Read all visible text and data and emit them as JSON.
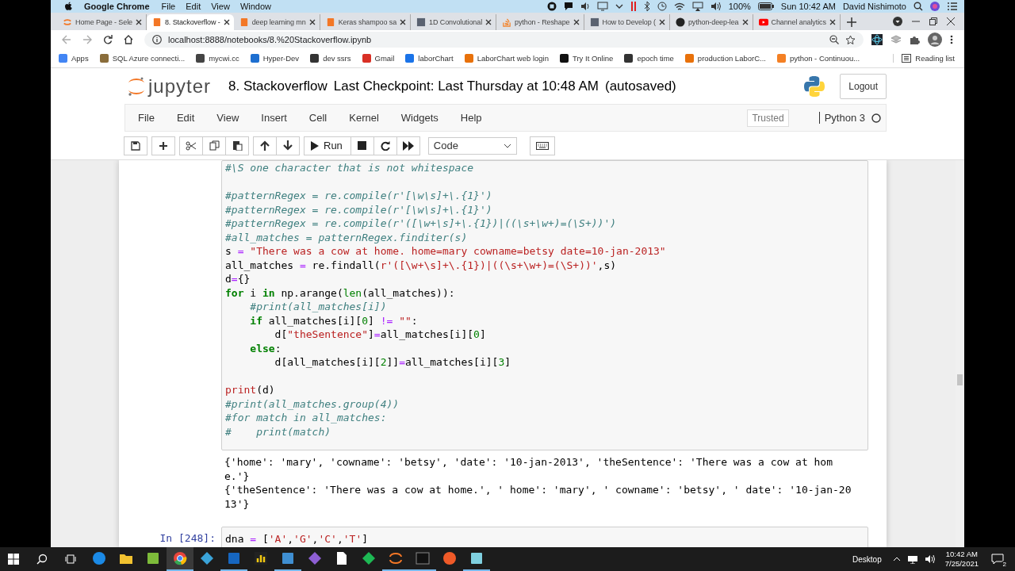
{
  "mac_menubar": {
    "app": "Google Chrome",
    "menus": [
      "File",
      "Edit",
      "View",
      "Window"
    ],
    "battery": "100%",
    "clock": "Sun 10:42 AM",
    "user": "David Nishimoto"
  },
  "tabs": [
    {
      "title": "Home Page - Sele",
      "kind": "jupyter",
      "selected": false
    },
    {
      "title": "8. Stackoverflow -",
      "kind": "notebook",
      "selected": true
    },
    {
      "title": "deep learning mn",
      "kind": "notebook",
      "selected": false
    },
    {
      "title": "Keras shampoo sa",
      "kind": "notebook",
      "selected": false
    },
    {
      "title": "1D Convolutional",
      "kind": "image",
      "selected": false
    },
    {
      "title": "python - Reshape",
      "kind": "stackoverflow",
      "selected": false
    },
    {
      "title": "How to Develop (",
      "kind": "image",
      "selected": false
    },
    {
      "title": "python-deep-lea",
      "kind": "github",
      "selected": false
    },
    {
      "title": "Channel analytics",
      "kind": "youtube",
      "selected": false
    }
  ],
  "address": "localhost:8888/notebooks/8.%20Stackoverflow.ipynb",
  "bookmarks": [
    {
      "label": "Apps",
      "color": "#4285f4"
    },
    {
      "label": "SQL Azure connecti...",
      "color": "#8a6d3b"
    },
    {
      "label": "mycwi.cc",
      "color": "#444444"
    },
    {
      "label": "Hyper-Dev",
      "color": "#1e6fd0"
    },
    {
      "label": "dev ssrs",
      "color": "#333333"
    },
    {
      "label": "Gmail",
      "color": "#d93025"
    },
    {
      "label": "laborChart",
      "color": "#1a73e8"
    },
    {
      "label": "LaborChart web login",
      "color": "#e8710a"
    },
    {
      "label": "Try It Online",
      "color": "#111111"
    },
    {
      "label": "epoch time",
      "color": "#333333"
    },
    {
      "label": "production LaborC...",
      "color": "#e8710a"
    },
    {
      "label": "python - Continuou...",
      "color": "#f48024"
    }
  ],
  "reading_list": "Reading list",
  "jupyter": {
    "logo_text": "jupyter",
    "notebook_name": "8. Stackoverflow",
    "checkpoint": "Last Checkpoint: Last Thursday at 10:48 AM",
    "autosave": "(autosaved)",
    "logout": "Logout",
    "menus": [
      "File",
      "Edit",
      "View",
      "Insert",
      "Cell",
      "Kernel",
      "Widgets",
      "Help"
    ],
    "trusted": "Trusted",
    "kernel": {
      "name": "Python 3",
      "busy": false
    },
    "run_label": "Run",
    "cell_type": "Code"
  },
  "cells": [
    {
      "lines": [
        {
          "kind": "code",
          "tokens": [
            {
              "kind": "comment",
              "text": "#\\S one character that is not whitespace"
            }
          ]
        },
        {
          "kind": "blank"
        },
        {
          "kind": "code",
          "tokens": [
            {
              "kind": "comment",
              "text": "#patternRegex = re.compile(r'[\\w\\s]+\\.{1}')"
            }
          ]
        },
        {
          "kind": "code",
          "tokens": [
            {
              "kind": "comment",
              "text": "#patternRegex = re.compile(r'[\\w\\s]+\\.{1}')"
            }
          ]
        },
        {
          "kind": "code",
          "tokens": [
            {
              "kind": "comment",
              "text": "#patternRegex = re.compile(r'([\\w+\\s]+\\.{1})|((\\s+\\w+)=(\\S+))')"
            }
          ]
        },
        {
          "kind": "code",
          "tokens": [
            {
              "kind": "comment",
              "text": "#all_matches = patternRegex.finditer(s)"
            }
          ]
        },
        {
          "kind": "code",
          "tokens": [
            {
              "kind": "plain",
              "text": "s "
            },
            {
              "kind": "operator",
              "text": "="
            },
            {
              "kind": "string",
              "text": " \"There was a cow at home. home=mary cowname=betsy date=10-jan-2013\""
            }
          ]
        },
        {
          "kind": "code",
          "tokens": [
            {
              "kind": "plain",
              "text": "all_matches "
            },
            {
              "kind": "operator",
              "text": "="
            },
            {
              "kind": "plain",
              "text": " re.findall("
            },
            {
              "kind": "string",
              "text": "r'([\\w+\\s]+\\.{1})|((\\s+\\w+)=(\\S+))'"
            },
            {
              "kind": "plain",
              "text": ",s)"
            }
          ]
        },
        {
          "kind": "code",
          "tokens": [
            {
              "kind": "plain",
              "text": "d"
            },
            {
              "kind": "operator",
              "text": "="
            },
            {
              "kind": "plain",
              "text": "{}"
            }
          ]
        },
        {
          "kind": "code",
          "tokens": [
            {
              "kind": "keyword",
              "text": "for"
            },
            {
              "kind": "plain",
              "text": " i "
            },
            {
              "kind": "keyword",
              "text": "in"
            },
            {
              "kind": "plain",
              "text": " np.arange("
            },
            {
              "kind": "builtin",
              "text": "len"
            },
            {
              "kind": "plain",
              "text": "(all_matches)):"
            }
          ]
        },
        {
          "kind": "code",
          "tokens": [
            {
              "kind": "comment",
              "text": "    #print(all_matches[i])"
            }
          ]
        },
        {
          "kind": "code",
          "tokens": [
            {
              "kind": "keyword",
              "text": "    if"
            },
            {
              "kind": "plain",
              "text": " all_matches[i]["
            },
            {
              "kind": "number",
              "text": "0"
            },
            {
              "kind": "plain",
              "text": "] "
            },
            {
              "kind": "operator",
              "text": "!="
            },
            {
              "kind": "string",
              "text": " \"\""
            },
            {
              "kind": "plain",
              "text": ":"
            }
          ]
        },
        {
          "kind": "code",
          "tokens": [
            {
              "kind": "plain",
              "text": "        d["
            },
            {
              "kind": "string",
              "text": "\"theSentence\""
            },
            {
              "kind": "plain",
              "text": "]"
            },
            {
              "kind": "operator",
              "text": "="
            },
            {
              "kind": "plain",
              "text": "all_matches[i]["
            },
            {
              "kind": "number",
              "text": "0"
            },
            {
              "kind": "plain",
              "text": "]"
            }
          ]
        },
        {
          "kind": "code",
          "tokens": [
            {
              "kind": "keyword",
              "text": "    else"
            },
            {
              "kind": "plain",
              "text": ":"
            }
          ]
        },
        {
          "kind": "code",
          "tokens": [
            {
              "kind": "plain",
              "text": "        d[all_matches[i]["
            },
            {
              "kind": "number",
              "text": "2"
            },
            {
              "kind": "plain",
              "text": "]]"
            },
            {
              "kind": "operator",
              "text": "="
            },
            {
              "kind": "plain",
              "text": "all_matches[i]["
            },
            {
              "kind": "number",
              "text": "3"
            },
            {
              "kind": "plain",
              "text": "]"
            }
          ]
        },
        {
          "kind": "blank"
        },
        {
          "kind": "code",
          "tokens": [
            {
              "kind": "function",
              "text": "print"
            },
            {
              "kind": "plain",
              "text": "(d)"
            }
          ]
        },
        {
          "kind": "code",
          "tokens": [
            {
              "kind": "comment",
              "text": "#print(all_matches.group(4))"
            }
          ]
        },
        {
          "kind": "code",
          "tokens": [
            {
              "kind": "comment",
              "text": "#for match in all_matches:"
            }
          ]
        },
        {
          "kind": "code",
          "tokens": [
            {
              "kind": "comment",
              "text": "#    print(match)"
            }
          ]
        }
      ],
      "output": [
        "{'home': 'mary', 'cowname': 'betsy', 'date': '10-jan-2013', 'theSentence': 'There was a cow at hom",
        "e.'}",
        "{'theSentence': 'There was a cow at home.', ' home': 'mary', ' cowname': 'betsy', ' date': '10-jan-20",
        "13'}"
      ]
    },
    {
      "prompt": "In [248]:",
      "lines": [
        {
          "kind": "code",
          "tokens": [
            {
              "kind": "plain",
              "text": "dna "
            },
            {
              "kind": "operator",
              "text": "="
            },
            {
              "kind": "plain",
              "text": " ["
            },
            {
              "kind": "string",
              "text": "'A'"
            },
            {
              "kind": "plain",
              "text": ","
            },
            {
              "kind": "string",
              "text": "'G'"
            },
            {
              "kind": "plain",
              "text": ","
            },
            {
              "kind": "string",
              "text": "'C'"
            },
            {
              "kind": "plain",
              "text": ","
            },
            {
              "kind": "string",
              "text": "'T'"
            },
            {
              "kind": "plain",
              "text": "]"
            }
          ]
        }
      ]
    }
  ],
  "taskbar": {
    "apps": [
      {
        "kind": "edge",
        "selected": false,
        "open": false
      },
      {
        "kind": "explorer",
        "selected": false,
        "open": false
      },
      {
        "kind": "tool",
        "selected": false,
        "open": false
      },
      {
        "kind": "chrome",
        "selected": true,
        "open": true
      },
      {
        "kind": "arrow",
        "selected": false,
        "open": false
      },
      {
        "kind": "outlook",
        "selected": false,
        "open": true
      },
      {
        "kind": "chart",
        "selected": false,
        "open": false
      },
      {
        "kind": "shell",
        "selected": false,
        "open": true
      },
      {
        "kind": "studio",
        "selected": false,
        "open": false
      },
      {
        "kind": "document",
        "selected": false,
        "open": false
      },
      {
        "kind": "diamond",
        "selected": false,
        "open": false
      },
      {
        "kind": "jupyter",
        "selected": false,
        "open": true
      },
      {
        "kind": "terminal",
        "selected": false,
        "open": true
      },
      {
        "kind": "compass",
        "selected": false,
        "open": false
      },
      {
        "kind": "notepad",
        "selected": false,
        "open": true
      }
    ],
    "desktop": "Desktop",
    "time": "10:42 AM",
    "date": "7/25/2021",
    "notifications": "2"
  }
}
